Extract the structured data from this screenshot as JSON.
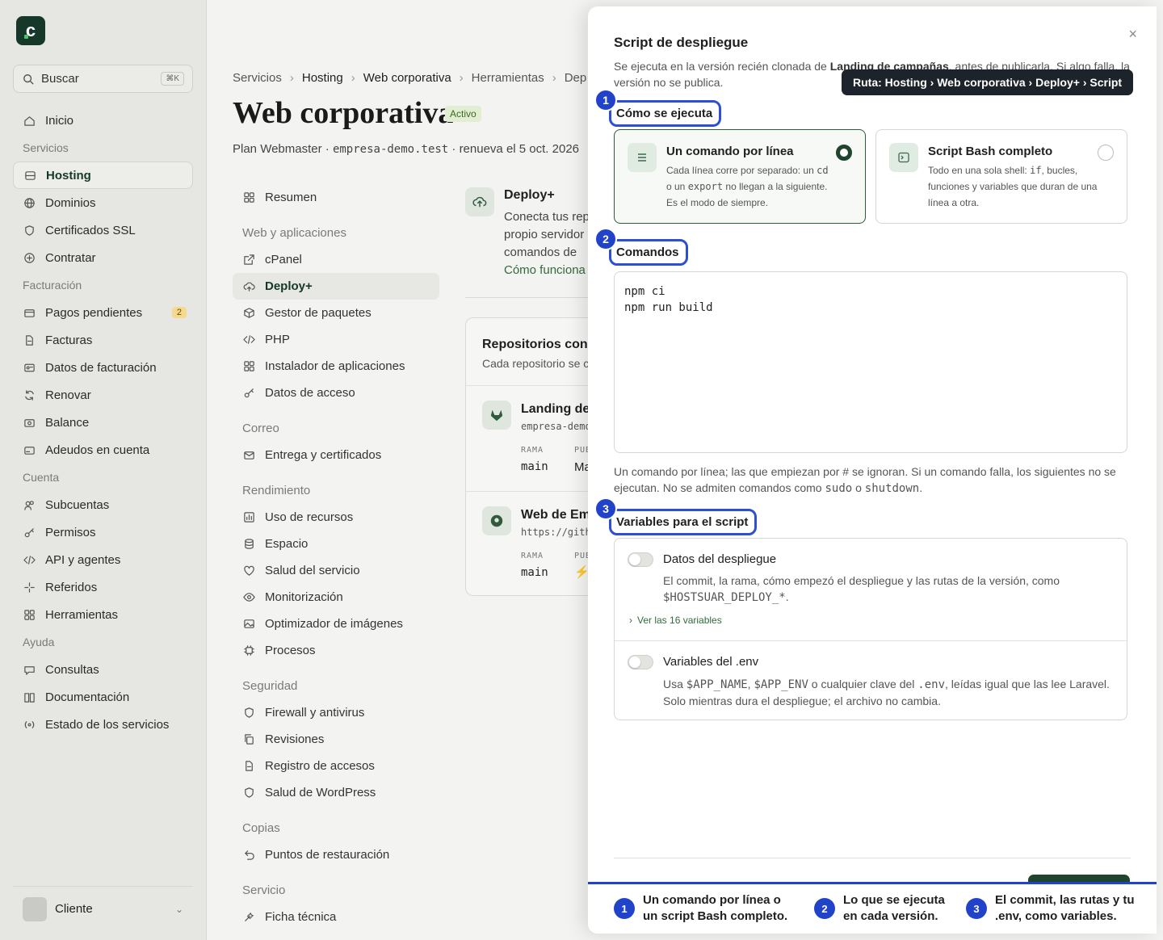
{
  "sidebar": {
    "logo": "c",
    "search_label": "Buscar",
    "search_kbd": "⌘K",
    "items": [
      {
        "type": "item",
        "label": "Inicio",
        "icon": "home-icon"
      },
      {
        "type": "section",
        "label": "Servicios"
      },
      {
        "type": "item",
        "label": "Hosting",
        "icon": "server-icon",
        "active": true
      },
      {
        "type": "item",
        "label": "Dominios",
        "icon": "globe-icon"
      },
      {
        "type": "item",
        "label": "Certificados SSL",
        "icon": "shield-icon"
      },
      {
        "type": "item",
        "label": "Contratar",
        "icon": "plus-circle-icon"
      },
      {
        "type": "section",
        "label": "Facturación"
      },
      {
        "type": "item",
        "label": "Pagos pendientes",
        "icon": "card-icon",
        "badge": "2"
      },
      {
        "type": "item",
        "label": "Facturas",
        "icon": "file-icon"
      },
      {
        "type": "item",
        "label": "Datos de facturación",
        "icon": "id-card-icon"
      },
      {
        "type": "item",
        "label": "Renovar",
        "icon": "refresh-icon"
      },
      {
        "type": "item",
        "label": "Balance",
        "icon": "wallet-icon"
      },
      {
        "type": "item",
        "label": "Adeudos en cuenta",
        "icon": "bank-icon"
      },
      {
        "type": "section",
        "label": "Cuenta"
      },
      {
        "type": "item",
        "label": "Subcuentas",
        "icon": "users-icon"
      },
      {
        "type": "item",
        "label": "Permisos",
        "icon": "key-icon"
      },
      {
        "type": "item",
        "label": "API y agentes",
        "icon": "code-icon"
      },
      {
        "type": "item",
        "label": "Referidos",
        "icon": "sparkle-icon"
      },
      {
        "type": "item",
        "label": "Herramientas",
        "icon": "grid-icon"
      },
      {
        "type": "section",
        "label": "Ayuda"
      },
      {
        "type": "item",
        "label": "Consultas",
        "icon": "chat-icon"
      },
      {
        "type": "item",
        "label": "Documentación",
        "icon": "book-icon"
      },
      {
        "type": "item",
        "label": "Estado de los servicios",
        "icon": "signal-icon"
      }
    ],
    "user_name": "Cliente"
  },
  "main": {
    "breadcrumb": [
      "Servicios",
      "Hosting",
      "Web corporativa",
      "Herramientas",
      "Dep"
    ],
    "title": "Web corporativa",
    "status": "Activo",
    "plan_prefix": "Plan Webmaster · ",
    "plan_domain": "empresa-demo.test",
    "plan_suffix": " · renueva el 5 oct. 2026",
    "subnav": [
      {
        "type": "item",
        "label": "Resumen",
        "icon": "grid-icon"
      },
      {
        "type": "section",
        "label": "Web y aplicaciones"
      },
      {
        "type": "item",
        "label": "cPanel",
        "icon": "external-link-icon"
      },
      {
        "type": "item",
        "label": "Deploy+",
        "icon": "cloud-upload-icon",
        "active": true
      },
      {
        "type": "item",
        "label": "Gestor de paquetes",
        "icon": "package-icon"
      },
      {
        "type": "item",
        "label": "PHP",
        "icon": "code-icon"
      },
      {
        "type": "item",
        "label": "Instalador de aplicaciones",
        "icon": "grid-icon"
      },
      {
        "type": "item",
        "label": "Datos de acceso",
        "icon": "key-icon"
      },
      {
        "type": "section",
        "label": "Correo"
      },
      {
        "type": "item",
        "label": "Entrega y certificados",
        "icon": "mail-icon"
      },
      {
        "type": "section",
        "label": "Rendimiento"
      },
      {
        "type": "item",
        "label": "Uso de recursos",
        "icon": "chart-icon"
      },
      {
        "type": "item",
        "label": "Espacio",
        "icon": "database-icon"
      },
      {
        "type": "item",
        "label": "Salud del servicio",
        "icon": "heart-icon"
      },
      {
        "type": "item",
        "label": "Monitorización",
        "icon": "eye-icon"
      },
      {
        "type": "item",
        "label": "Optimizador de imágenes",
        "icon": "image-icon"
      },
      {
        "type": "item",
        "label": "Procesos",
        "icon": "cpu-icon"
      },
      {
        "type": "section",
        "label": "Seguridad"
      },
      {
        "type": "item",
        "label": "Firewall y antivirus",
        "icon": "shield-icon"
      },
      {
        "type": "item",
        "label": "Revisiones",
        "icon": "copy-icon"
      },
      {
        "type": "item",
        "label": "Registro de accesos",
        "icon": "file-icon"
      },
      {
        "type": "item",
        "label": "Salud de WordPress",
        "icon": "shield-icon"
      },
      {
        "type": "section",
        "label": "Copias"
      },
      {
        "type": "item",
        "label": "Puntos de restauración",
        "icon": "undo-icon"
      },
      {
        "type": "section",
        "label": "Servicio"
      },
      {
        "type": "item",
        "label": "Ficha técnica",
        "icon": "tools-icon"
      }
    ],
    "deploy": {
      "title": "Deploy+",
      "desc": "Conecta tus repo propio servidor G tus comandos de",
      "link": "Cómo funciona"
    },
    "repos": {
      "title": "Repositorios cone",
      "subtitle": "Cada repositorio se c",
      "items": [
        {
          "name": "Landing de",
          "url": "empresa-demo",
          "branch_label": "RAMA",
          "branch": "main",
          "pub_label": "PUB",
          "pub": "Ma"
        },
        {
          "name": "Web de Em",
          "url": "https://gith",
          "branch_label": "RAMA",
          "branch": "main",
          "pub_label": "PUB",
          "pub": "⚡"
        }
      ]
    }
  },
  "modal": {
    "title": "Script de despliegue",
    "close": "×",
    "desc_prefix": "Se ejecuta en la versión recién clonada de ",
    "desc_bold": "Landing de campañas",
    "desc_suffix": ", antes de publicarla. Si algo falla, la versión no se publica.",
    "tooltip": "Ruta: Hosting › Web corporativa › Deploy+ › Script",
    "section1": {
      "num": "1",
      "label": "Cómo se ejecuta"
    },
    "option1": {
      "title": "Un comando por línea",
      "desc_a": "Cada línea corre por separado: un ",
      "code_a": "cd",
      "desc_b": " o un ",
      "code_b": "export",
      "desc_c": " no llegan a la siguiente. Es el modo de siempre."
    },
    "option2": {
      "title": "Script Bash completo",
      "desc_a": "Todo en una sola shell: ",
      "code_a": "if",
      "desc_b": ", bucles, funciones y variables que duran de una línea a otra."
    },
    "section2": {
      "num": "2",
      "label": "Comandos"
    },
    "commands": "npm ci\nnpm run build",
    "hint_a": "Un comando por línea; las que empiezan por # se ignoran. Si un comando falla, los siguientes no se ejecutan. No se admiten comandos como ",
    "hint_code1": "sudo",
    "hint_b": " o ",
    "hint_code2": "shutdown",
    "hint_c": ".",
    "section3": {
      "num": "3",
      "label": "Variables para el script"
    },
    "var1": {
      "title": "Datos del despliegue",
      "desc": "El commit, la rama, cómo empezó el despliegue y las rutas de la versión, como ",
      "code": "$HOSTSUAR_DEPLOY_*",
      "end": ".",
      "link": "Ver las 16 variables"
    },
    "var2": {
      "title": "Variables del .env",
      "desc_a": "Usa ",
      "code_a": "$APP_NAME",
      "desc_b": ", ",
      "code_b": "$APP_ENV",
      "desc_c": " o cualquier clave del ",
      "code_c": ".env",
      "desc_d": ", leídas igual que las lee Laravel. Solo mientras dura el despliegue; el archivo no cambia."
    },
    "steps": [
      {
        "num": "1",
        "text": "Un comando por línea o un script Bash completo."
      },
      {
        "num": "2",
        "text": "Lo que se ejecuta en cada versión."
      },
      {
        "num": "3",
        "text": "El commit, las rutas y tu .env, como variables."
      }
    ]
  },
  "colors": {
    "brand": "#16382a",
    "accent": "#2143c9",
    "link": "#2f6b3d"
  }
}
